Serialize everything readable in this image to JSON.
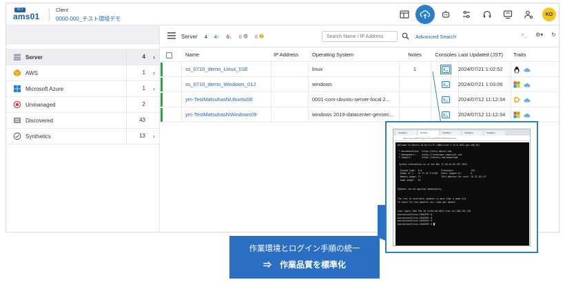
{
  "header": {
    "logo_tag": "ｱﾙﾌｧ",
    "logo_text": "ams01",
    "client_label": "Client",
    "client_name": "0000-000_テスト環境デモ",
    "avatar_initials": "KO",
    "accent_color": "#2a7fc9",
    "icons": [
      "layout-icon",
      "cloud-upload-icon",
      "robot-icon",
      "sliders-icon",
      "headset-icon",
      "monitor-icon",
      "user-settings-icon"
    ]
  },
  "sidebar": {
    "items": [
      {
        "label": "Server",
        "count": "4",
        "icon": "server-icon",
        "selected": true,
        "chevron": true
      },
      {
        "label": "AWS",
        "count": "1",
        "icon": "aws-icon",
        "chevron": true
      },
      {
        "label": "Microsoft Azure",
        "count": "1",
        "icon": "windows-icon",
        "chevron": true
      },
      {
        "label": "Unmanaged",
        "count": "2",
        "icon": "unmanaged-icon",
        "chevron": false
      },
      {
        "label": "Discovered",
        "count": "43",
        "icon": "discovered-icon",
        "chevron": false
      },
      {
        "label": "Synthetics",
        "count": "13",
        "icon": "check-circle-icon",
        "chevron": true
      }
    ]
  },
  "toolbar": {
    "title": "Server",
    "badges": [
      {
        "text": "4",
        "color": "#1f63b5"
      },
      {
        "text": "4↑",
        "color": "#2ba34a"
      },
      {
        "text": "0↓",
        "color": "#d93025"
      },
      {
        "text": "0",
        "color": "#999999"
      },
      {
        "text": "0",
        "color": "#999999"
      }
    ],
    "search_placeholder": "Search Name / IP Address",
    "advanced_search": "Advanced Search",
    "right_icons": [
      ">_",
      "⚙▾",
      "↻"
    ]
  },
  "table": {
    "columns": [
      "Name",
      "IP Address",
      "Operating System",
      "Notes",
      "Consoles",
      "Last Updated (JST)",
      "Traits"
    ],
    "rows": [
      {
        "name": "ss_0710_demo_Linux_01E",
        "ip": "",
        "os": "linux",
        "notes": "1",
        "updated": "2024/07/21 1:02:52",
        "traits": [
          "linux-icon",
          "cloud-icon"
        ],
        "highlight": true
      },
      {
        "name": "ss_0710_demo_Windows_01J",
        "ip": "",
        "os": "windows",
        "notes": "",
        "updated": "2024/07/21 1:03:06",
        "traits": [
          "windows-icon",
          "cloud-icon"
        ],
        "highlight": false
      },
      {
        "name": "ym-TestMatsuhashiUbuntu08",
        "ip": "",
        "os": "0001-com-ubuntu-server-focal 2...",
        "notes": "",
        "updated": "2024/07/12 11:12:34",
        "traits": [
          "ubuntu-icon",
          "cloud-icon"
        ],
        "highlight": false
      },
      {
        "name": "ym-TestMatsuhashiWindows09",
        "ip": "",
        "os": "windows 2019-datacenter-gensec...",
        "notes": "",
        "updated": "2024/07/12 11:12:34",
        "traits": [
          "windows-icon",
          "cloud-icon"
        ],
        "highlight": false
      }
    ]
  },
  "popup": {
    "tabs": [
      "Opsflame",
      "NTMA1",
      "Opsflame",
      "Opsflame",
      "Opsflame"
    ],
    "url": "https://ocg-web01/?ggook.cloud.jp/#/VM/NTMA1/Terminal",
    "terminal_text": "Welcome to Ubuntu 20.04.6 LTS (GNU/Linux 5.15.0-1052-gcp x86_64)\n\n * Documentation:  https://help.ubuntu.com\n * Management:     https://landscape.canonical.com\n * Support:        https://ubuntu.com/advantage\n\n System information as of Sat Mar 11 02:44:20 UTC 2023\n\n  System load:  0.0               Processes:             118\n  Usage of /:   47.7% of 9.52GB   Users logged in:       0\n  Memory usage: 7%                IPv4 address for ens4: 10.22.161.47\n  Swap usage:   0%\n\n\nUpdates can be applied immediately.\n\n\nThe list of available updates is more than a week old.\nTo check for new updates run: sudo apt update\n\n\nLast login: Mon Feb 20 14:04:46 2023 from 111.108.251.135\nmaintainer@linux-23e8399:~$\nmaintainer@linux-23e8399:~$\nmaintainer@linux-23e8399:~$\nmaintainer@linux-23e8399:~$ █"
  },
  "banner": {
    "line1": "作業環境とログイン手順の統一",
    "line2": "⇒　作業品質を標準化",
    "color": "#2a6fc4"
  }
}
